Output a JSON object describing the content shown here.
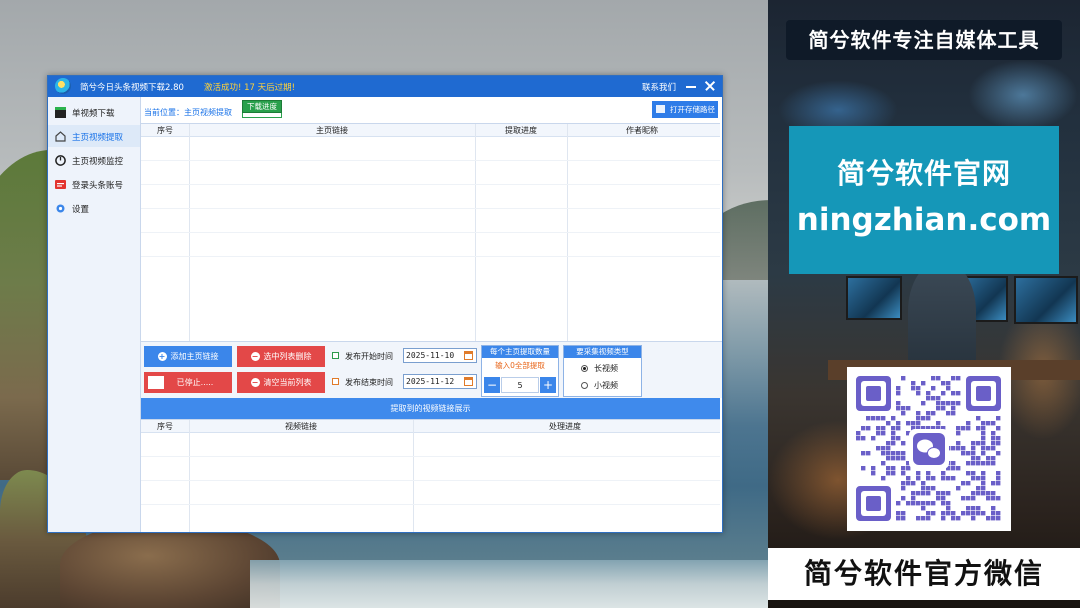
{
  "window": {
    "title": "简兮今日头条视频下载2.80",
    "activation": "激活成功!  17 天后过期!",
    "contact": "联系我们"
  },
  "sidebar": {
    "items": [
      {
        "label": "单视频下载",
        "icon": "clapperboard-icon",
        "active": false
      },
      {
        "label": "主页视频提取",
        "icon": "home-icon",
        "active": true
      },
      {
        "label": "主页视频监控",
        "icon": "monitor-icon",
        "active": false
      },
      {
        "label": "登录头条账号",
        "icon": "toutiao-icon",
        "active": false
      },
      {
        "label": "设置",
        "icon": "gear-icon",
        "active": false
      }
    ]
  },
  "main": {
    "breadcrumb": "当前位置：主页视频提取",
    "progress_tag": "下载进度",
    "open_folder": "打开存储路径",
    "table1": {
      "headers": [
        "序号",
        "主页链接",
        "提取进度",
        "作者昵称"
      ]
    },
    "buttons": {
      "add_link": "添加主页链接",
      "delete_selected": "选中列表删除",
      "stopped": "已停止.....",
      "clear_list": "清空当前列表"
    },
    "publish_start_label": "发布开始时间",
    "publish_start_date": "2025-11-10",
    "publish_end_label": "发布结束时间",
    "publish_end_date": "2025-11-12",
    "count": {
      "title": "每个主页提取数量",
      "hint": "输入0全部提取",
      "value": "5",
      "minus": "−",
      "plus": "+"
    },
    "video_type": {
      "title": "要采集视频类型",
      "options": [
        "长视频",
        "小视频"
      ],
      "selected": "长视频"
    },
    "section2_title": "提取到的视频链接展示",
    "table2": {
      "headers": [
        "序号",
        "视频链接",
        "处理进度"
      ]
    }
  },
  "promo": {
    "top_banner": "简兮软件专注自媒体工具",
    "site_title": "简兮软件官网",
    "site_url": "ningzhian.com",
    "bottom_banner": "简兮软件官方微信",
    "qr_icon": "wechat-icon"
  },
  "colors": {
    "titlebar": "#1f6ad1",
    "accent": "#3b86ea",
    "danger": "#e34848",
    "site_panel": "#1597b8"
  }
}
